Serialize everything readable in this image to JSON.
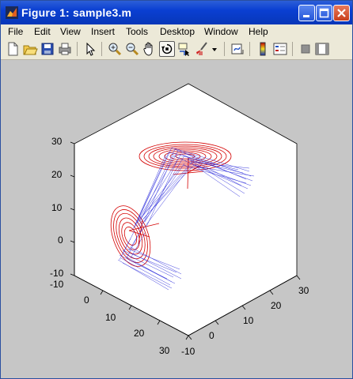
{
  "window": {
    "title": "Figure 1: sample3.m",
    "minimize_icon": "minimize-icon",
    "maximize_icon": "maximize-icon",
    "close_icon": "close-icon"
  },
  "menu": {
    "items": [
      "File",
      "Edit",
      "View",
      "Insert",
      "Tools",
      "Desktop",
      "Window",
      "Help"
    ]
  },
  "toolbar": {
    "buttons": [
      "new-figure-icon",
      "open-file-icon",
      "save-icon",
      "print-icon",
      "edit-plot-arrow-icon",
      "zoom-in-icon",
      "zoom-out-icon",
      "pan-hand-icon",
      "rotate-3d-icon",
      "data-cursor-icon",
      "brush-icon",
      "brush-dropdown-icon",
      "link-plot-icon",
      "insert-colorbar-icon",
      "insert-legend-icon",
      "hide-plot-tools-icon",
      "show-plot-tools-icon"
    ]
  },
  "axes": {
    "z_ticks": [
      "30",
      "20",
      "10",
      "0",
      "-10"
    ],
    "x_ticks": [
      "-10",
      "0",
      "10",
      "20",
      "30"
    ],
    "y_ticks": [
      "-10",
      "0",
      "10",
      "20",
      "30"
    ],
    "colors": {
      "blue_lines": "#1b1bd8",
      "red_rings": "#d40000",
      "box_face": "#ffffff",
      "background": "#c6c6c6"
    }
  }
}
